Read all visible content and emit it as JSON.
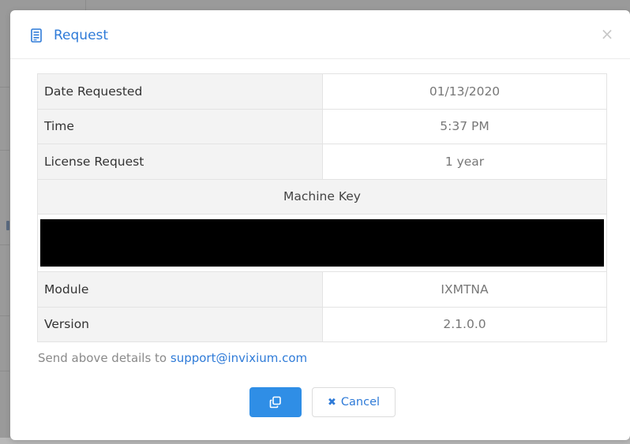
{
  "modal": {
    "title": "Request",
    "icon": "document-icon",
    "close_icon": "close-icon",
    "close_glyph": "×"
  },
  "details": {
    "rows": [
      {
        "label": "Date Requested",
        "value": "01/13/2020"
      },
      {
        "label": "Time",
        "value": "5:37 PM"
      },
      {
        "label": "License Request",
        "value": "1 year"
      }
    ],
    "machine_key_header": "Machine Key",
    "machine_key_value": "",
    "rows_after": [
      {
        "label": "Module",
        "value": "IXMTNA"
      },
      {
        "label": "Version",
        "value": "2.1.0.0"
      }
    ]
  },
  "note": {
    "prefix": "Send above details to ",
    "email": "support@invixium.com"
  },
  "buttons": {
    "copy_icon": "copy-icon",
    "cancel_glyph": "✖",
    "cancel_label": "Cancel"
  },
  "colors": {
    "accent": "#2f7bd8",
    "button_primary": "#2f8ee6",
    "redaction": "#000000"
  }
}
